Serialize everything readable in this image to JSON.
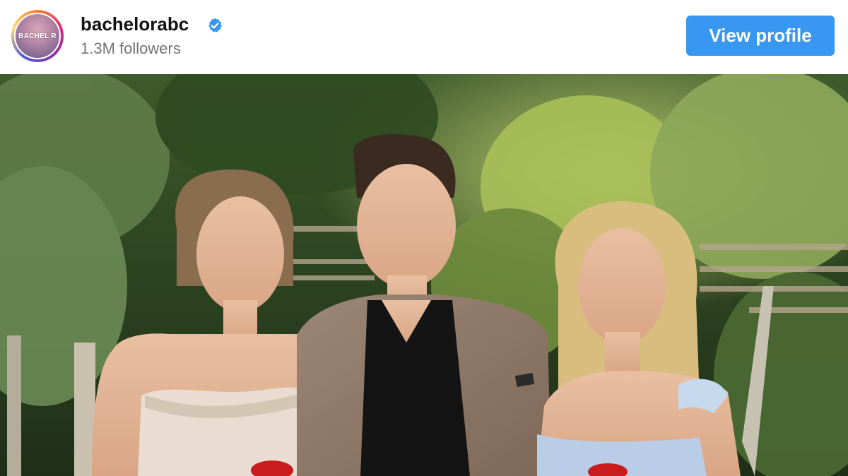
{
  "profile": {
    "avatar_text": "BACHEL R",
    "username": "bachelorabc",
    "verified_icon": "verified-badge-icon",
    "followers": "1.3M followers",
    "view_profile_label": "View profile"
  },
  "colors": {
    "button": "#3897f0",
    "verified": "#3897f0",
    "followers_text": "#737373"
  },
  "post": {
    "image_alt": "photo"
  }
}
